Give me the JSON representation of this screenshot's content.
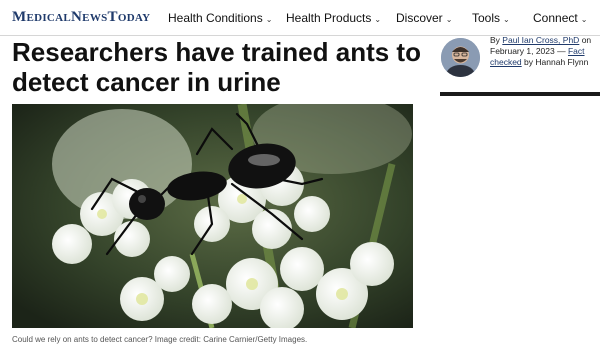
{
  "header": {
    "logo": "MedicalNewsToday",
    "nav": [
      {
        "label": "Health Conditions"
      },
      {
        "label": "Health Products"
      },
      {
        "label": "Discover"
      },
      {
        "label": "Tools"
      },
      {
        "label": "Connect"
      }
    ]
  },
  "article": {
    "headline": "Researchers have trained ants to detect cancer in urine",
    "caption": "Could we rely on ants to detect cancer? Image credit: Carine Carnier/Getty Images."
  },
  "byline": {
    "by": "By",
    "author": "Paul Ian Cross, PhD",
    "on": "on",
    "date_line": "February 1, 2023 —",
    "fact_checked": "Fact checked",
    "by2": "by",
    "checker": "Hannah Flynn"
  },
  "icons": {
    "nav_chevron": "chevron-down-icon"
  }
}
